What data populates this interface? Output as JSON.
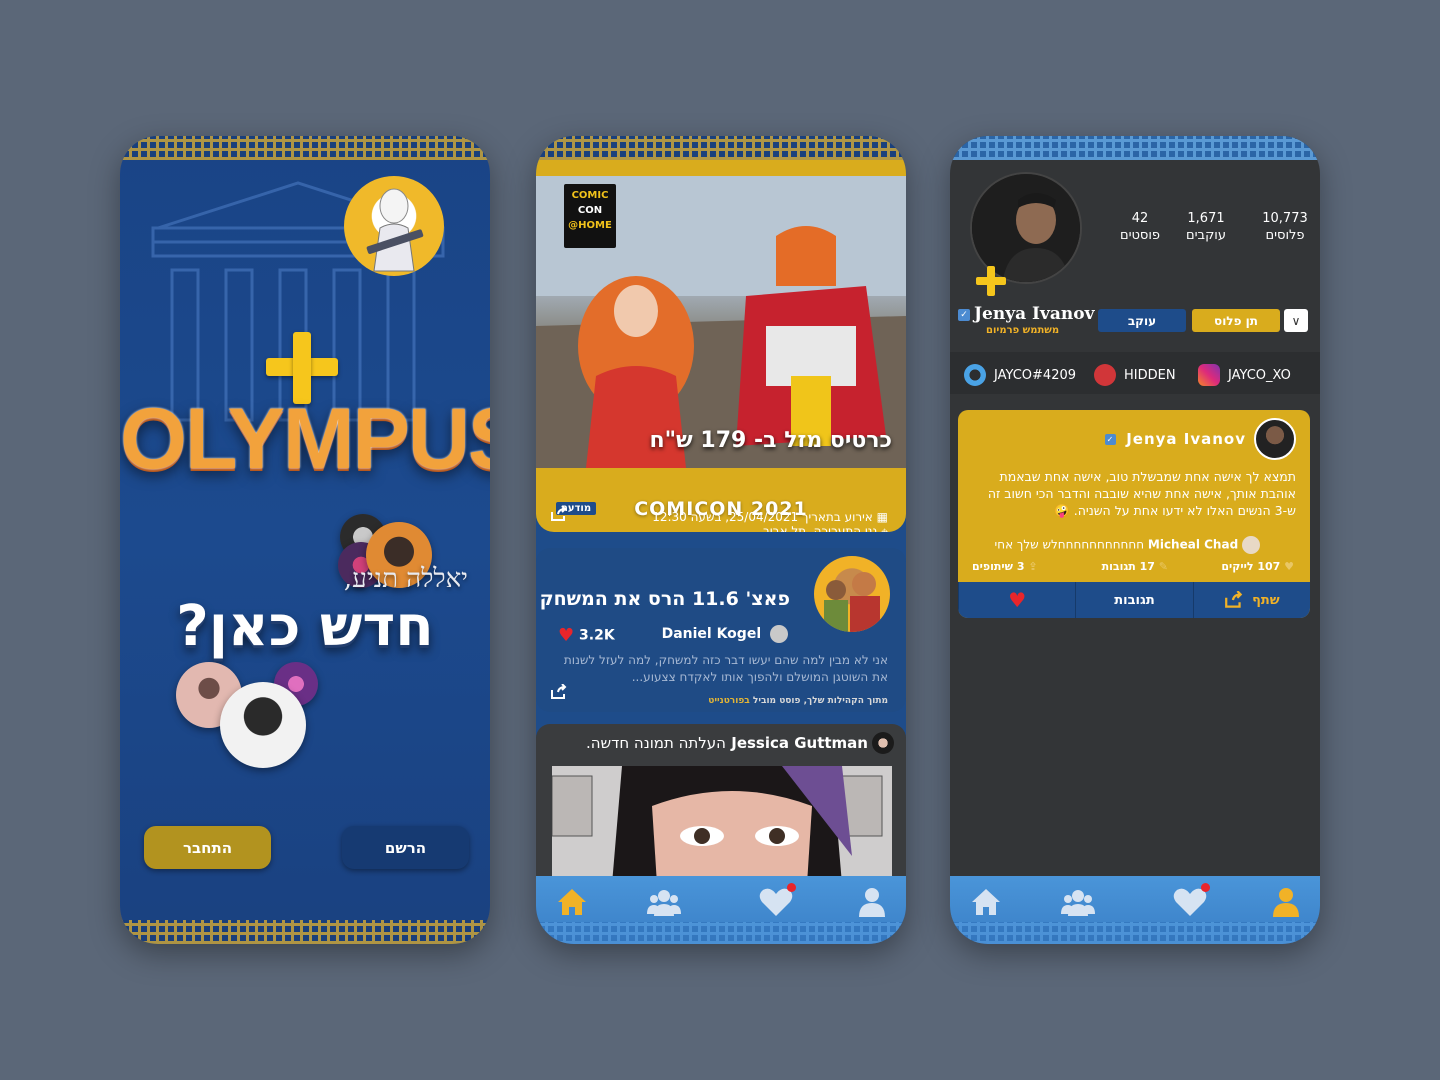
{
  "colors": {
    "background": "#5b6778",
    "gold": "#d9ac1d",
    "navy": "#1e4c8a",
    "tabbar": "#4a95d9",
    "dark": "#333537"
  },
  "welcome": {
    "logo": "OLYMPUS",
    "greeting": "יאללה תניע,",
    "headline": "חדש כאן?",
    "login_button": "התחבר",
    "register_button": "הרשם"
  },
  "feed": {
    "event": {
      "logo_lines": [
        "COMIC",
        "CON",
        "@HOME"
      ],
      "title": "כרטיס מזל ב- 179 ש\"ח",
      "name": "COMICON 2021",
      "badge": "מודעה",
      "location": "גני התערוכה, תל אביב",
      "datetime": "אירוע בתאריך 25/04/2021, בשעה 12:30"
    },
    "post": {
      "title": "פאצ' 11.6 הרס את המשחק",
      "author": "Daniel Kogel",
      "likes": "3.2K",
      "body": "אני לא מבין למה שהם יעשו דבר כזה למשחק, למה לעזל לשנות את השוטגן המושלם ולהפוך אותו לאקדח צצעוע...",
      "footer_prefix": "מתוך הקהילות שלך, פוסט מוביל",
      "footer_link": "בפורטנייט"
    },
    "photo_post": {
      "author": "Jessica Guttman",
      "text": "העלתה תמונה חדשה."
    }
  },
  "profile": {
    "stats": [
      {
        "value": "10,773",
        "label": "פלוסים"
      },
      {
        "value": "1,671",
        "label": "עוקבים"
      },
      {
        "value": "42",
        "label": "פוסטים"
      }
    ],
    "name": "Jenya Ivanov",
    "subtitle": "משתמש פרמיום",
    "give_plus_button": "תן פלוס",
    "follow_button": "עוקב",
    "socials": [
      {
        "icon": "instagram-icon",
        "handle": "JAYCO_XO"
      },
      {
        "icon": "riot-icon",
        "handle": "HIDDEN"
      },
      {
        "icon": "battlenet-icon",
        "handle": "JAYCO#4209"
      }
    ],
    "card": {
      "author": "Jenya Ivanov",
      "text": "תמצא לך אישה אחת שמבשלת טוב, אישה אחת שבאמת אוהבת אותך, אישה אחת שהיא שובבה והדבר הכי חשוב זה ש-3 הנשים האלו לא ידעו אחת על השניה. 🤪",
      "reply_author": "Micheal Chad",
      "reply_text": "חחחחחחחחחחחלש שלך אחי",
      "likes": "107 לייקים",
      "comments": "17 תגובות",
      "shares": "3 שיתופים",
      "share_button": "שתף",
      "comments_button": "תגובות"
    }
  }
}
